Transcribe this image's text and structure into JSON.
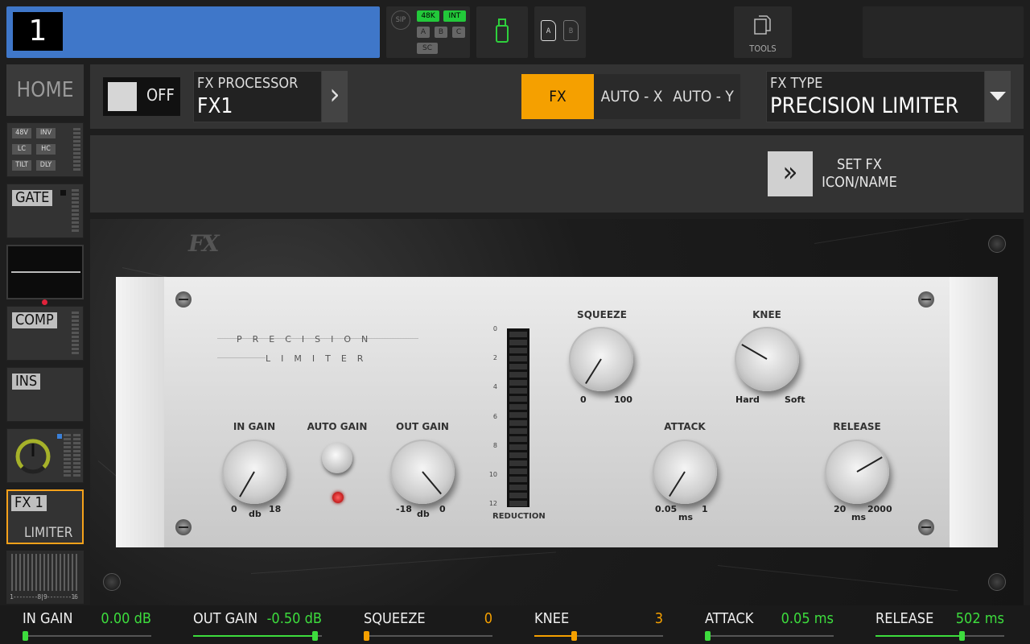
{
  "channel": {
    "number": "1"
  },
  "status": {
    "sip": "SIP",
    "rate": "48K",
    "clock": "INT",
    "bus": [
      "A",
      "B",
      "C"
    ],
    "sc": "SC"
  },
  "cards": {
    "a": "A",
    "b": "B"
  },
  "tools": {
    "label": "TOOLS"
  },
  "sidebar": {
    "home": "HOME",
    "input_tags": [
      "48V",
      "INV",
      "LC",
      "HC",
      "TILT",
      "DLY"
    ],
    "gate": "GATE",
    "comp": "COMP",
    "ins": "INS",
    "fx_slot": "FX 1",
    "fx_sub": "LIMITER",
    "meter_scale": "1--------8|9--------16"
  },
  "header": {
    "onoff": "OFF",
    "fx_processor_label": "FX PROCESSOR",
    "fx_processor_value": "FX1",
    "tabs": [
      "FX",
      "AUTO - X",
      "AUTO - Y"
    ],
    "active_tab": "FX",
    "fx_type_label": "FX TYPE",
    "fx_type_value": "PRECISION LIMITER"
  },
  "setfx": {
    "line1": "SET FX",
    "line2": "ICON/NAME"
  },
  "rack": {
    "logo": "FX",
    "brand_line1": "PRECISION",
    "brand_line2": "LIMITER",
    "knobs": {
      "in_gain": {
        "label": "IN GAIN",
        "min": "0",
        "max": "18",
        "unit": "db"
      },
      "auto_gain": {
        "label": "AUTO GAIN"
      },
      "out_gain": {
        "label": "OUT GAIN",
        "min": "-18",
        "max": "0",
        "unit": "db"
      },
      "squeeze": {
        "label": "SQUEEZE",
        "min": "0",
        "max": "100"
      },
      "knee": {
        "label": "KNEE",
        "min": "Hard",
        "max": "Soft"
      },
      "attack": {
        "label": "ATTACK",
        "min": "0.05",
        "max": "1",
        "unit": "ms"
      },
      "release": {
        "label": "RELEASE",
        "min": "20",
        "max": "2000",
        "unit": "ms"
      }
    },
    "meter_ticks": [
      "0",
      "2",
      "4",
      "6",
      "8",
      "10",
      "12"
    ],
    "meter_label": "REDUCTION"
  },
  "params": [
    {
      "name": "IN GAIN",
      "value": "0.00 dB",
      "color": "#3ddc3d",
      "level": 0.0
    },
    {
      "name": "OUT GAIN",
      "value": "-0.50 dB",
      "color": "#3ddc3d",
      "level": 0.97
    },
    {
      "name": "SQUEEZE",
      "value": "0",
      "color": "#f5a000",
      "level": 0.0
    },
    {
      "name": "KNEE",
      "value": "3",
      "color": "#f5a000",
      "level": 0.3
    },
    {
      "name": "ATTACK",
      "value": "0.05 ms",
      "color": "#3ddc3d",
      "level": 0.0
    },
    {
      "name": "RELEASE",
      "value": "502 ms",
      "color": "#3ddc3d",
      "level": 0.68
    }
  ]
}
